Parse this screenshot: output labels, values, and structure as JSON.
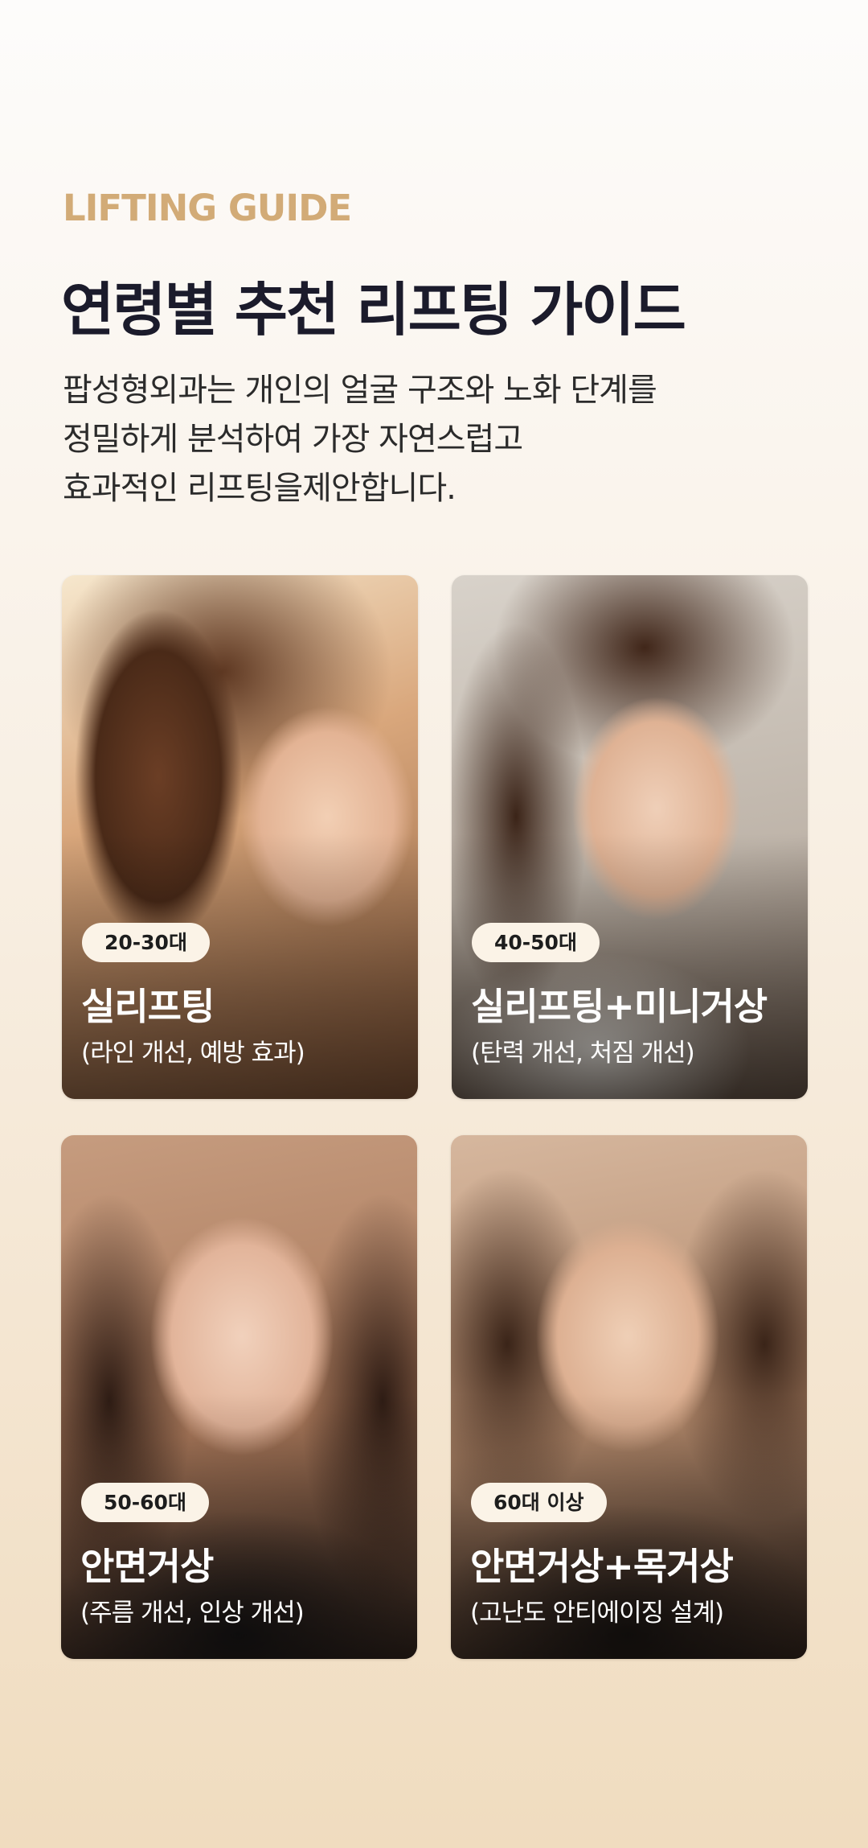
{
  "header": {
    "eyebrow": "LIFTING GUIDE",
    "title": "연령별 추천 리프팅 가이드",
    "description_lines": [
      "팝성형외과는 개인의 얼굴 구조와 노화 단계를",
      "정밀하게 분석하여 가장 자연스럽고",
      "효과적인 리프팅을제안합니다."
    ]
  },
  "cards": [
    {
      "badge": "20-30대",
      "name": "실리프팅",
      "detail": "(라인 개선, 예방 효과)"
    },
    {
      "badge": "40-50대",
      "name": "실리프팅+미니거상",
      "detail": "(탄력 개선, 처짐 개선)"
    },
    {
      "badge": "50-60대",
      "name": "안면거상",
      "detail": "(주름 개선, 인상 개선)"
    },
    {
      "badge": "60대 이상",
      "name": "안면거상+목거상",
      "detail": "(고난도 안티에이징 설계)"
    }
  ],
  "colors": {
    "accent": "#d2ab77",
    "title": "#1b1b2b",
    "badge_bg": "#fbf3e7"
  }
}
